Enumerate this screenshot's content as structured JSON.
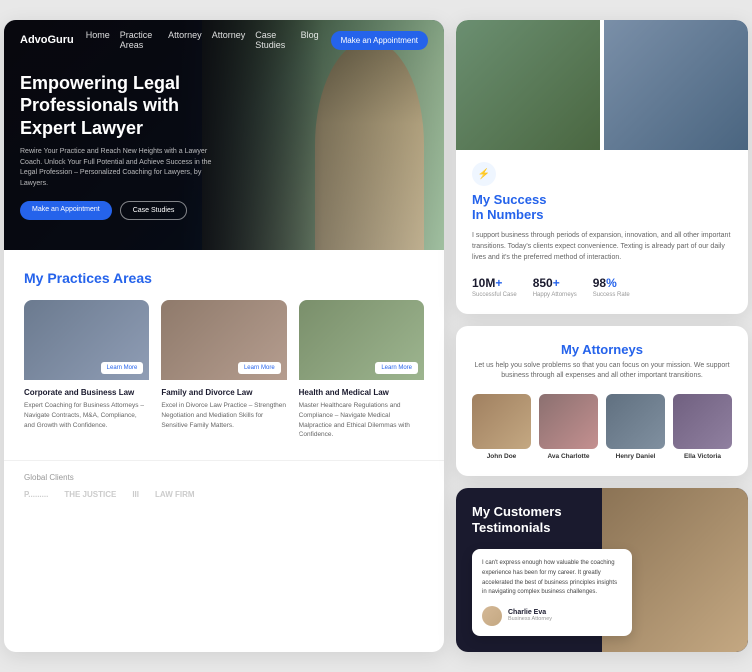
{
  "nav": {
    "logo": "AdvoGuru",
    "links": [
      "Home",
      "Practice Areas",
      "Attorney",
      "Attorney",
      "Case Studies",
      "Blog"
    ],
    "cta": "Make an Appointment"
  },
  "hero": {
    "title": "Empowering Legal\nProfessionals with\nExpert Lawyer",
    "subtitle": "Rewire Your Practice and Reach New Heights with a Lawyer Coach. Unlock Your Full Potential and Achieve Success in the Legal Profession – Personalized Coaching for Lawyers, by Lawyers.",
    "btn_primary": "Make an Appointment",
    "btn_secondary": "Case Studies"
  },
  "practices": {
    "section_label": "My ",
    "section_highlight": "Practices Areas",
    "cards": [
      {
        "title": "Corporate and Business Law",
        "description": "Expert Coaching for Business Attorneys – Navigate Contracts, M&A, Compliance, and Growth with Confidence.",
        "learn_more": "Learn More"
      },
      {
        "title": "Family and Divorce Law",
        "description": "Excel in Divorce Law Practice – Strengthen Negotiation and Mediation Skills for Sensitive Family Matters.",
        "learn_more": "Learn More"
      },
      {
        "title": "Health and Medical Law",
        "description": "Master Healthcare Regulations and Compliance – Navigate Medical Malpractice and Ethical Dilemmas with Confidence.",
        "learn_more": "Learn More"
      }
    ]
  },
  "clients": {
    "label": "Global Clients",
    "logos": [
      "P.........",
      "THE JUSTICE",
      "III",
      "LAW FIRM"
    ]
  },
  "success": {
    "icon": "⚡",
    "heading_prefix": "My ",
    "heading_highlight": "Success",
    "heading_suffix": "\nIn Numbers",
    "description": "I support business through periods of expansion, innovation, and all other important transitions. Today's clients expect convenience. Texting is already part of our daily lives and it's the preferred method of interaction.",
    "stats": [
      {
        "value": "10M",
        "suffix": "+",
        "label": "Successful Case"
      },
      {
        "value": "850",
        "suffix": "+",
        "label": "Happy Attorneys"
      },
      {
        "value": "98",
        "suffix": "%",
        "label": "Success Rate"
      }
    ]
  },
  "attorneys": {
    "heading_prefix": "My ",
    "heading_highlight": "Attorneys",
    "description": "Let us help you solve problems so that you can focus on your mission. We support business through all expenses and all other important transitions.",
    "list": [
      {
        "name": "John Doe"
      },
      {
        "name": "Ava Charlotte"
      },
      {
        "name": "Henry Daniel"
      },
      {
        "name": "Ella Victoria"
      }
    ]
  },
  "testimonials": {
    "title": "My Customers\nTestimonials",
    "text": "I can't express enough how valuable the coaching experience has been for my career. It greatly accelerated the best of business principles insights in navigating complex business challenges.",
    "author_name": "Charlie Eva",
    "author_role": "Business Attorney"
  }
}
